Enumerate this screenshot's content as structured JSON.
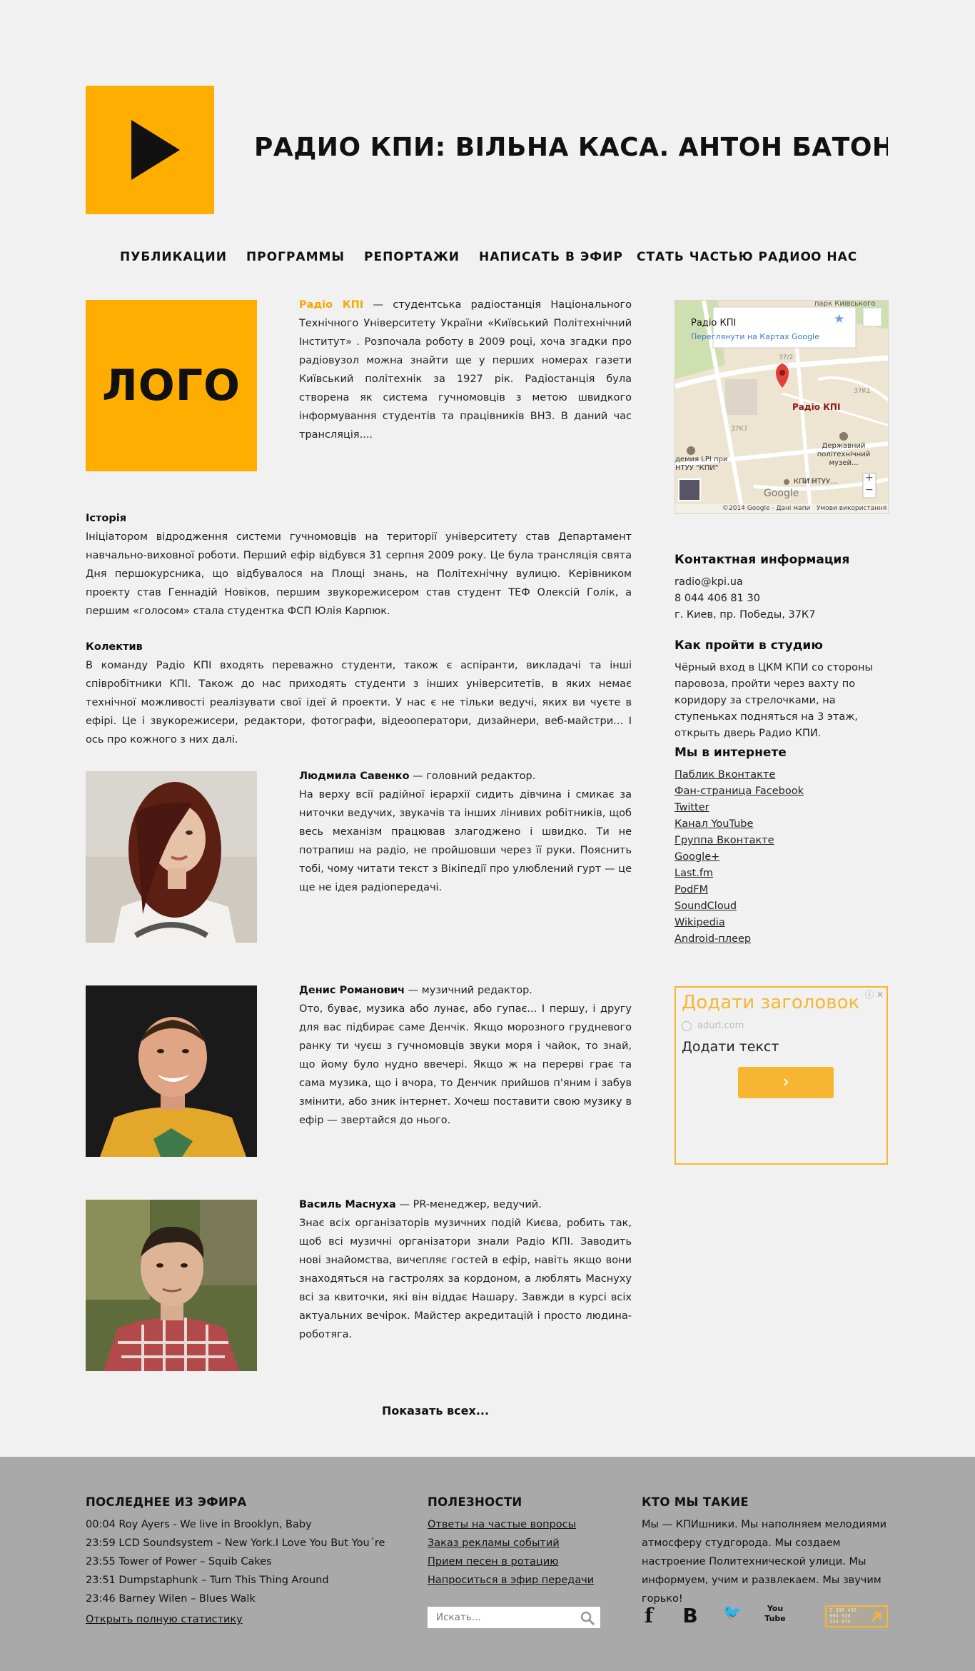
{
  "header": {
    "now_playing": "РАДИО КПИ:   ВІЛЬНА КАСА. АНТОН БАТОН З МІС"
  },
  "nav": [
    {
      "label": "ПУБЛИКАЦИИ"
    },
    {
      "label": "ПРОГРАММЫ"
    },
    {
      "label": "РЕПОРТАЖИ"
    },
    {
      "label": "НАПИСАТЬ В ЭФИР"
    },
    {
      "label": "СТАТЬ ЧАСТЬЮ РАДИО"
    },
    {
      "label": "О НАС"
    }
  ],
  "about": {
    "logo_text": "ЛОГО",
    "station_name": "Радіо КПІ",
    "intro": " — студентська радіостанція Національного Технічного Університету України «Київський Політехнічний Інститут» . Розпочала роботу в 2009 році, хоча згадки про радіовузол можна знайти ще у перших номерах газети Київський політехнік за 1927 рік. Радіостанція була створена як система гучномовців з метою швидкого інформування студентів та працівників ВНЗ. В даний час трансляція...."
  },
  "history": {
    "title": "Історія",
    "text": "Ініціатором відродження системи гучномовців на території університету став Департамент навчально-виховної роботи. Перший ефір відбувся 31 серпня 2009 року. Це була трансляція свята Дня першокурсника, що відбувалося на Площі знань, на Політехнічну вулицю. Керівником проекту став Геннадій Новіков, першим звукорежисером став студент ТЕФ Олексій Голік, а першим «голосом» стала студентка ФСП Юлія Карпюк."
  },
  "team": {
    "title": "Колектив",
    "text": "В команду Радіо КПІ входять переважно студенти, також є аспіранти, викладачі та інші співробітники КПІ. Також до нас приходять студенти з інших університетів, в яких немає технічної можливості реалізувати свої ідеї й проекти. У нас є не тільки ведучі, яких ви чуєте в ефірі. Це і звукорежисери, редактори, фотографи, відеооператори, дизайнери, веб-майстри... І ось про кожного з них далі."
  },
  "members": [
    {
      "name": "Людмила Савенко",
      "role": " — головний редактор.",
      "bio": "На верху всії радійної ієрархії сидить дівчина і смикає за ниточки ведучих, звукачів та інших лінивих робітників, щоб весь механізм працював злагоджено і швидко. Ти не потрапиш на радіо, не пройшовши через її руки. Пояснить тобі, чому читати текст з Вікіпедії про улюблений гурт — це ще не ідея радіопередачі."
    },
    {
      "name": "Денис Романович",
      "role": " — музичний редактор.",
      "bio": "Ото, буває, музика або лунає, або гупає... І першу, і другу для вас підбирає саме Денчік. Якщо морозного грудневого ранку ти чуєш з гучномовців звуки моря і чайок, то знай, що йому було нудно ввечері. Якщо ж на перерві грає та сама музика, що і вчора, то Денчик прийшов п'яним і забув змінити, або зник інтернет. Хочеш поставити свою музику в ефір — звертайся до нього."
    },
    {
      "name": "Василь Маснуха",
      "role": " — PR-менеджер, ведучий.",
      "bio": "Знає всіх організаторів музичних подій Києва, робить так, щоб всі музичні організатори знали Радіо КПІ. Заводить нові знайомства, вичепляє гостей в ефір, навіть якщо вони знаходяться на гастролях за кордоном, а люблять Маснуху всі за квиточки, які він віддає Нашару. Завжди в курсі всіх актуальних вечірок. Майстер акредитацій і просто людина-роботяга."
    }
  ],
  "show_all": "Показать всех...",
  "map": {
    "place_name": "Радіо КПІ",
    "view_link": "Переглянути на Картах Google",
    "marker_label": "Радіо КПІ",
    "park_label": "парк Київського",
    "museum_label": "Державний політехнічний музей...",
    "academy_label": "демия LPI при НТУУ \"КПИ\"",
    "kpi_label": "КПИ НТУУ...",
    "b_372": "37/2",
    "b_37k1": "37К1",
    "b_37k7": "37К7",
    "b_373": "37/3",
    "logo": "Google",
    "copyright": "©2014 Google - Дані мапи",
    "terms": "Умови використання",
    "zoom_in": "+",
    "zoom_out": "−",
    "star": "★"
  },
  "contact": {
    "title": "Контактная информация",
    "lines": [
      "radio@kpi.ua",
      "8 044 406 81 30",
      "г. Киев, пр. Победы, 37К7"
    ]
  },
  "route": {
    "title": "Как пройти в студию",
    "text": "Чёрный вход в ЦКМ КПИ со стороны паровоза, пройти через вахту по коридору за стрелочками, на ступеньках подняться на 3 этаж, открыть дверь Радио КПИ."
  },
  "internet": {
    "title": "Мы в интернете",
    "links": [
      "Паблик Вконтакте",
      "Фан-страница Facebook",
      "Twitter",
      "Канал YouTube",
      "Группа Вконтакте",
      "Google+",
      "Last.fm",
      "PodFM",
      "SoundCloud",
      "Wikipedia",
      "Android-плеер"
    ]
  },
  "ad": {
    "title": "Додати заголовок",
    "domain": "adurl.com",
    "text": "Додати текст",
    "btn": "›",
    "icons": "ⓘ ✕"
  },
  "footer": {
    "air": {
      "title": "ПОСЛЕДНЕЕ ИЗ ЭФИРА",
      "items": [
        "00:04 Roy Ayers - We live in Brooklyn, Baby",
        "23:59 LCD Soundsystem – New York.I Love You But You´re",
        "23:55 Tower of Power – Squib Cakes",
        "23:51 Dumpstaphunk – Turn This Thing Around",
        "23:46 Barney Wilen – Blues Walk"
      ],
      "link": "Открыть полную статистику"
    },
    "useful": {
      "title": "ПОЛЕЗНОСТИ",
      "links": [
        "Ответы на частые вопросы",
        "Заказ рекламы событий",
        "Прием песен в ротацию",
        "Напроситься в эфир передачи"
      ],
      "search_placeholder": "Искать..."
    },
    "who": {
      "title": "КТО МЫ ТАКИЕ",
      "text": "Мы — КПИшники. Мы наполняем мелодиями атмосферу студгорода. Мы создаем настроение Политехнической улици. Мы информуем, учим и развлекаем. Мы звучим горько!"
    },
    "social": {
      "facebook": "f",
      "vk": "B",
      "twitter": "🐦",
      "youtube": "You Tube"
    },
    "counter_digits": [
      "5 396 436",
      "994 920",
      "233 974"
    ]
  }
}
